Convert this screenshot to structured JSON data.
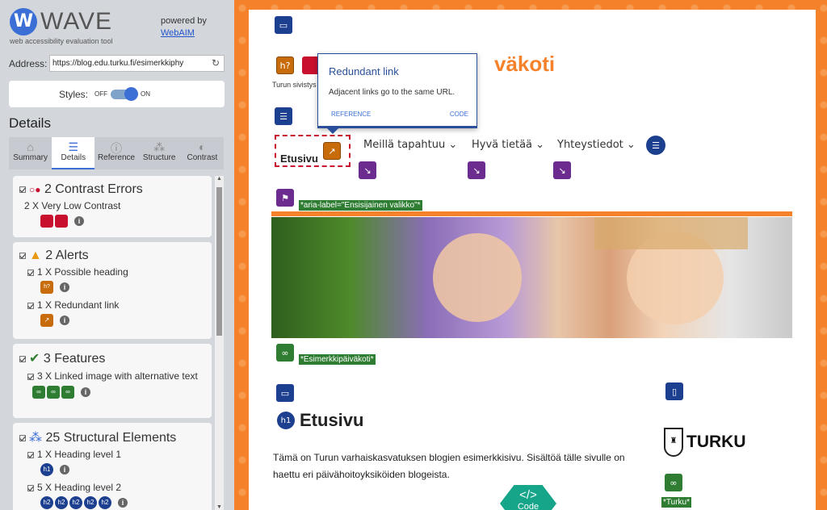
{
  "wave": {
    "title": "WAVE",
    "subtitle": "web accessibility evaluation tool",
    "powered": "powered by",
    "webaim": "WebAIM"
  },
  "address": {
    "label": "Address:",
    "value": "https://blog.edu.turku.fi/esimerkkiphy"
  },
  "styles": {
    "label": "Styles:",
    "off": "OFF",
    "on": "ON"
  },
  "details_heading": "Details",
  "tabs": [
    {
      "label": "Summary",
      "icon": "home-icon"
    },
    {
      "label": "Details",
      "icon": "list-icon"
    },
    {
      "label": "Reference",
      "icon": "info-icon"
    },
    {
      "label": "Structure",
      "icon": "sitemap-icon"
    },
    {
      "label": "Contrast",
      "icon": "contrast-icon"
    }
  ],
  "panel": {
    "contrast": {
      "title": "2 Contrast Errors",
      "item": "2 X Very Low Contrast"
    },
    "alerts": {
      "title": "2 Alerts",
      "item1": "1 X Possible heading",
      "item2": "1 X Redundant link"
    },
    "features": {
      "title": "3 Features",
      "item": "3 X Linked image with alternative text"
    },
    "structural": {
      "title": "25 Structural Elements",
      "item1": "1 X Heading level 1",
      "item2": "5 X Heading level 2"
    }
  },
  "tooltip": {
    "title": "Redundant link",
    "text": "Adjacent links go to the same URL.",
    "reference": "REFERENCE",
    "code": "CODE"
  },
  "site": {
    "title_partial": "väkoti",
    "subtitle_partial": "Turun sivistys",
    "nav": [
      "Etusivu",
      "Meillä tapahtuu",
      "Hyvä tietää",
      "Yhteystiedot"
    ],
    "aria_label": "*aria-label=\"Ensisijainen valikko\"*",
    "image_alt": "*Esimerkkipäiväkoti*",
    "heading": "Etusivu",
    "paragraph": "Tämä on Turun varhaiskasvatuksen blogien esimerkkisivu. Sisältöä tälle sivulle on haettu eri päivähoitoyksiköiden blogeista.",
    "turku": "TURKU",
    "turku_alt": "*Turku*",
    "code_label": "Code",
    "h1_badge": "h1",
    "h2_badge": "h2",
    "h_badge": "h?"
  },
  "colors": {
    "accent": "#3b6fd6",
    "orange": "#f5822a",
    "error": "#c8102e",
    "alert": "#c86b0a",
    "feature": "#2e7d32",
    "structure": "#1d3f8f",
    "aria": "#6b2b8f"
  }
}
